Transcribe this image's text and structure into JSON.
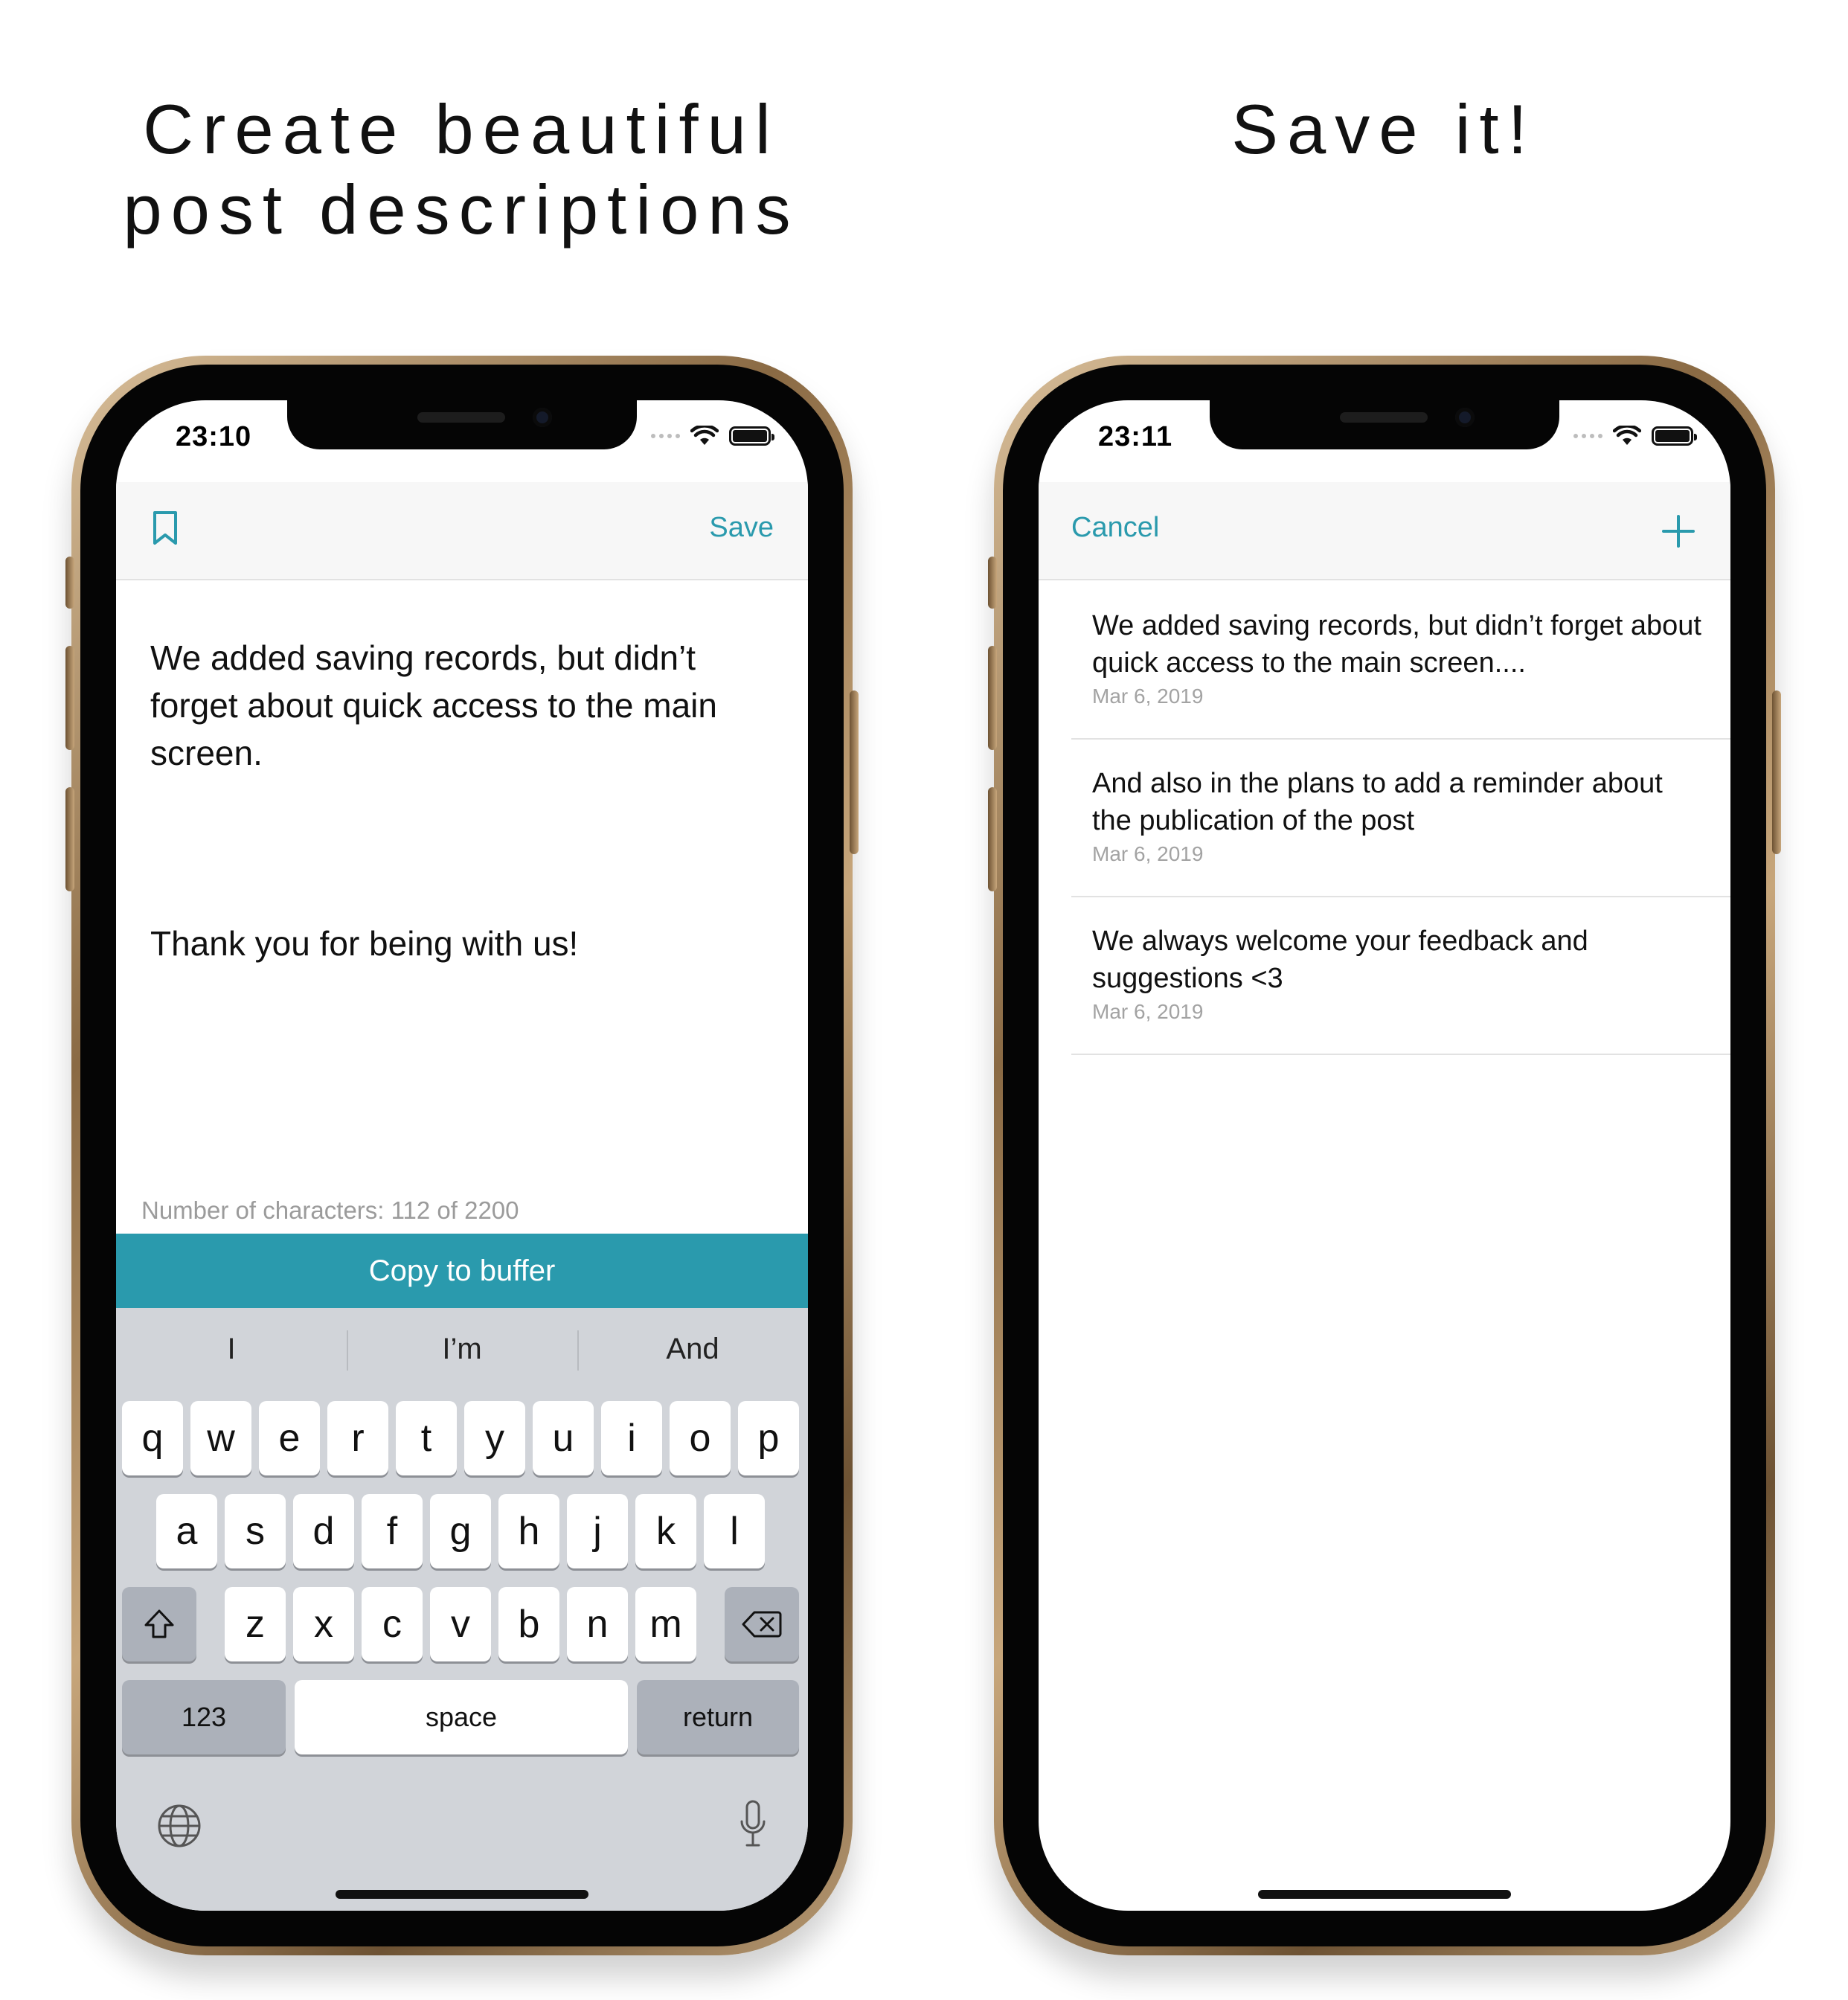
{
  "headlines": {
    "left_line1": "Create beautiful",
    "left_line2": "post descriptions",
    "right": "Save it!"
  },
  "editor_screen": {
    "status_time": "23:10",
    "nav": {
      "bookmark_icon": "bookmark-icon",
      "save_label": "Save"
    },
    "text_paragraph1": "We added saving records, but didn’t forget about quick access to the main screen.",
    "text_paragraph2": "Thank you for being with us!",
    "char_count": "Number of characters: 112 of 2200",
    "copy_button": "Copy to buffer",
    "suggestions": [
      "I",
      "I’m",
      "And"
    ],
    "keyboard": {
      "row1": [
        "q",
        "w",
        "e",
        "r",
        "t",
        "y",
        "u",
        "i",
        "o",
        "p"
      ],
      "row2": [
        "a",
        "s",
        "d",
        "f",
        "g",
        "h",
        "j",
        "k",
        "l"
      ],
      "row3": [
        "z",
        "x",
        "c",
        "v",
        "b",
        "n",
        "m"
      ],
      "numbers_key": "123",
      "space_key": "space",
      "return_key": "return",
      "shift_icon": "shift-icon",
      "delete_icon": "delete-icon",
      "globe_icon": "globe-icon",
      "mic_icon": "microphone-icon"
    }
  },
  "list_screen": {
    "status_time": "23:11",
    "nav": {
      "cancel_label": "Cancel",
      "add_icon": "plus-icon"
    },
    "items": [
      {
        "text": "We added saving records, but didn’t forget about quick access to the main screen....",
        "date": "Mar 6, 2019"
      },
      {
        "text": "And also in the plans to add a reminder about the publication of the post",
        "date": "Mar 6, 2019"
      },
      {
        "text": "We always welcome your feedback and suggestions <3",
        "date": "Mar 6, 2019"
      }
    ]
  },
  "colors": {
    "accent": "#2a9aad",
    "keyboard_bg": "#d1d4d9",
    "frame_gold": "#b89a73"
  }
}
